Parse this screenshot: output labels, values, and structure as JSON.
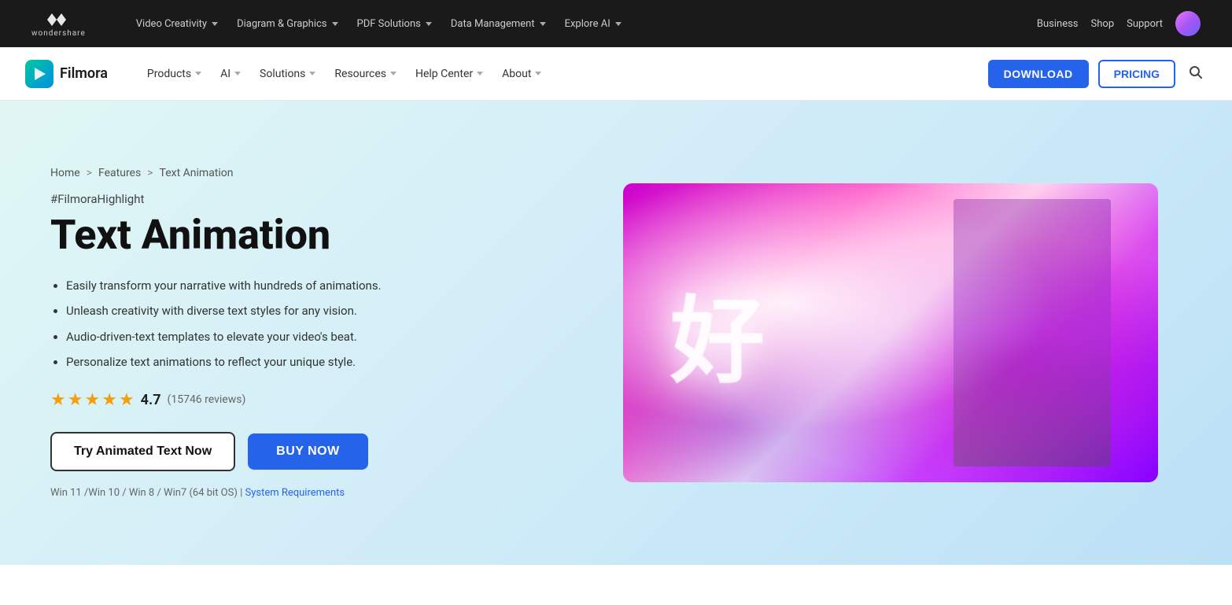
{
  "topNav": {
    "logoText": "wondershare",
    "items": [
      {
        "label": "Video Creativity",
        "hasDropdown": true
      },
      {
        "label": "Diagram & Graphics",
        "hasDropdown": true
      },
      {
        "label": "PDF Solutions",
        "hasDropdown": true
      },
      {
        "label": "Data Management",
        "hasDropdown": true
      },
      {
        "label": "Explore AI",
        "hasDropdown": true
      },
      {
        "label": "Business"
      },
      {
        "label": "Shop"
      },
      {
        "label": "Support"
      }
    ]
  },
  "secNav": {
    "brandName": "Filmora",
    "items": [
      {
        "label": "Products",
        "hasDropdown": true
      },
      {
        "label": "AI",
        "hasDropdown": true
      },
      {
        "label": "Solutions",
        "hasDropdown": true
      },
      {
        "label": "Resources",
        "hasDropdown": true
      },
      {
        "label": "Help Center",
        "hasDropdown": true
      },
      {
        "label": "About",
        "hasDropdown": true
      }
    ],
    "downloadLabel": "DOWNLOAD",
    "pricingLabel": "PRICING"
  },
  "hero": {
    "breadcrumb": {
      "home": "Home",
      "features": "Features",
      "current": "Text Animation"
    },
    "hashtag": "#FilmoraHighlight",
    "title": "Text Animation",
    "bullets": [
      "Easily transform your narrative with hundreds of animations.",
      "Unleash creativity with diverse text styles for any vision.",
      "Audio-driven-text templates to elevate your video's beat.",
      "Personalize text animations to reflect your unique style."
    ],
    "rating": {
      "score": "4.7",
      "reviewCount": "(15746 reviews)",
      "stars": [
        "full",
        "full",
        "full",
        "full",
        "half"
      ]
    },
    "tryButtonLabel": "Try Animated Text Now",
    "buyButtonLabel": "BUY NOW",
    "systemReqText": "Win 11 /Win 10 / Win 8 / Win7 (64 bit OS) |",
    "systemReqLink": "System Requirements"
  }
}
